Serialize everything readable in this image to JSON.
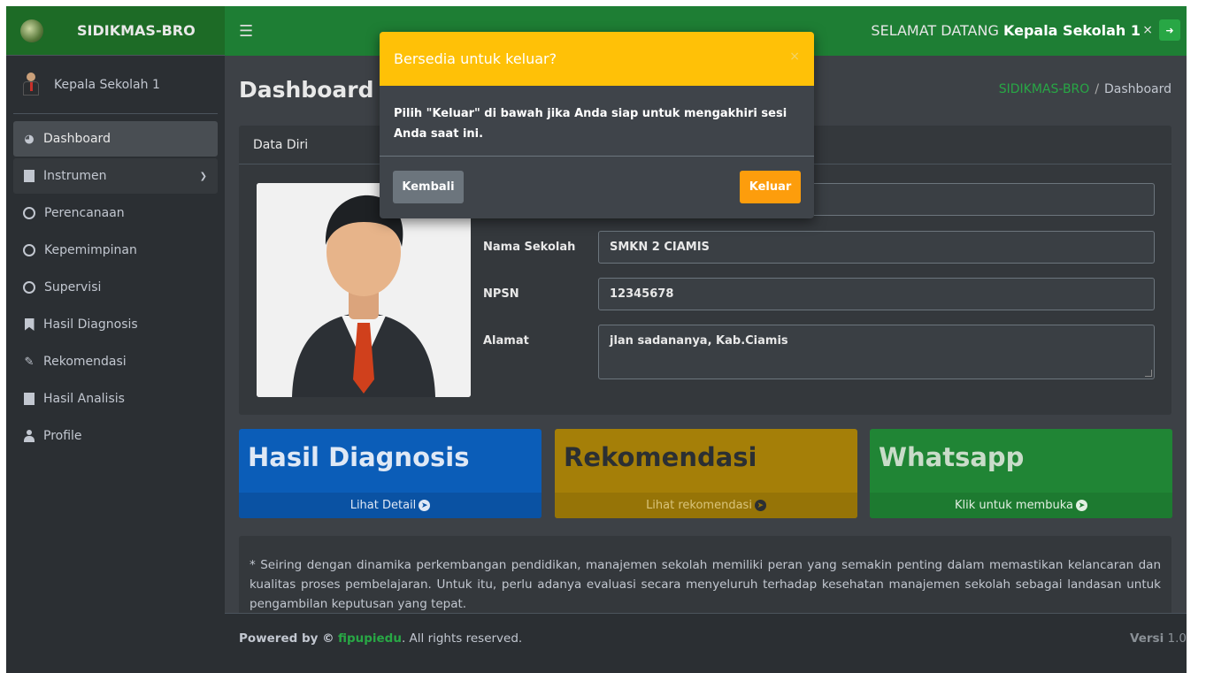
{
  "app": {
    "brand": "SIDIKMAS-BRO"
  },
  "header": {
    "welcome_prefix": "SELAMAT DATANG",
    "welcome_user": "Kepala Sekolah 1"
  },
  "sidebar": {
    "user_name": "Kepala Sekolah 1",
    "items": [
      {
        "label": "Dashboard",
        "icon": "dashboard-icon"
      },
      {
        "label": "Instrumen",
        "icon": "copy-icon"
      },
      {
        "label": "Perencanaan",
        "icon": "circle-icon"
      },
      {
        "label": "Kepemimpinan",
        "icon": "circle-icon"
      },
      {
        "label": "Supervisi",
        "icon": "circle-icon"
      },
      {
        "label": "Hasil Diagnosis",
        "icon": "bookmark-icon"
      },
      {
        "label": "Rekomendasi",
        "icon": "edit-icon"
      },
      {
        "label": "Hasil Analisis",
        "icon": "file-icon"
      },
      {
        "label": "Profile",
        "icon": "user-icon"
      }
    ]
  },
  "main": {
    "page_title": "Dashboard",
    "breadcrumb": {
      "home": "SIDIKMAS-BRO",
      "separator": "/",
      "current": "Dashboard"
    },
    "card_title": "Data Diri",
    "fields": {
      "nama_sekolah_label": "Nama Sekolah",
      "nama_sekolah_value": "SMKN 2 CIAMIS",
      "npsn_label": "NPSN",
      "npsn_value": "12345678",
      "alamat_label": "Alamat",
      "alamat_value": "jlan sadananya, Kab.Ciamis"
    },
    "tiles": [
      {
        "title": "Hasil Diagnosis",
        "footer": "Lihat Detail"
      },
      {
        "title": "Rekomendasi",
        "footer": "Lihat rekomendasi"
      },
      {
        "title": "Whatsapp",
        "footer": "Klik untuk membuka"
      }
    ],
    "note": "* Seiring dengan dinamika perkembangan pendidikan, manajemen sekolah memiliki peran yang semakin penting dalam memastikan kelancaran dan kualitas proses pembelajaran. Untuk itu, perlu adanya evaluasi secara menyeluruh terhadap kesehatan manajemen sekolah sebagai landasan untuk pengambilan keputusan yang tepat."
  },
  "footer": {
    "powered_prefix": "Powered by ©",
    "powered_link": "fipupiedu",
    "powered_suffix": ". All rights reserved.",
    "version_label": "Versi",
    "version_value": "1.0"
  },
  "modal": {
    "title": "Bersedia untuk keluar?",
    "close": "×",
    "body": "Pilih \"Keluar\" di bawah jika Anda siap untuk mengakhiri sesi Anda saat ini.",
    "cancel_label": "Kembali",
    "confirm_label": "Keluar"
  },
  "colors": {
    "brand_green": "#1e7e34",
    "modal_header": "#ffc107",
    "exit_button": "#fd9d0c",
    "tile_blue": "#0b5db8",
    "tile_yellow": "#a57f08",
    "tile_green": "#208535"
  }
}
